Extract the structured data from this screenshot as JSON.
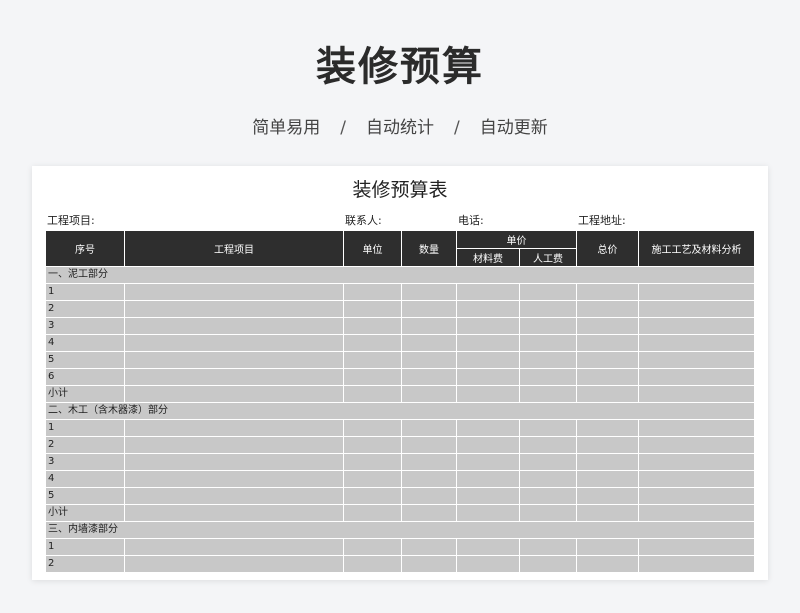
{
  "banner": {
    "title": "装修预算",
    "features": [
      "简单易用",
      "自动统计",
      "自动更新"
    ],
    "separator": "/"
  },
  "sheet": {
    "title": "装修预算表",
    "info": {
      "project": "工程项目:",
      "contact": "联系人:",
      "phone": "电话:",
      "address": "工程地址:"
    },
    "headers": {
      "seq": "序号",
      "item": "工程项目",
      "unit": "单位",
      "qty": "数量",
      "unit_price": "单价",
      "material": "材料费",
      "labor": "人工费",
      "total": "总价",
      "analysis": "施工工艺及材料分析"
    },
    "rows": [
      {
        "type": "section",
        "label": "一、泥工部分"
      },
      {
        "type": "item",
        "seq": "1"
      },
      {
        "type": "item",
        "seq": "2"
      },
      {
        "type": "item",
        "seq": "3"
      },
      {
        "type": "item",
        "seq": "4"
      },
      {
        "type": "item",
        "seq": "5"
      },
      {
        "type": "item",
        "seq": "6"
      },
      {
        "type": "item",
        "seq": "小计"
      },
      {
        "type": "section",
        "label": "二、木工（含木器漆）部分"
      },
      {
        "type": "item",
        "seq": "1"
      },
      {
        "type": "item",
        "seq": "2"
      },
      {
        "type": "item",
        "seq": "3"
      },
      {
        "type": "item",
        "seq": "4"
      },
      {
        "type": "item",
        "seq": "5"
      },
      {
        "type": "item",
        "seq": "小计"
      },
      {
        "type": "section",
        "label": "三、内墙漆部分"
      },
      {
        "type": "item",
        "seq": "1"
      },
      {
        "type": "item",
        "seq": "2"
      }
    ]
  }
}
